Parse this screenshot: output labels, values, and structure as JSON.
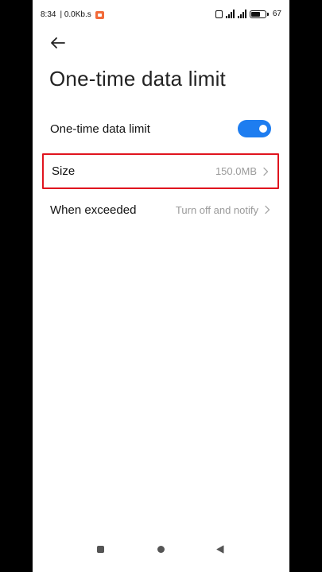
{
  "status_bar": {
    "time": "8:34",
    "network_speed": "| 0.0Kb.s",
    "battery_percent": "67",
    "icons": [
      "notification-icon",
      "vibrate-icon",
      "signal-icon",
      "signal-icon",
      "battery-icon"
    ]
  },
  "header": {
    "back_icon": "arrow-left-icon",
    "title": "One-time data limit"
  },
  "settings": {
    "toggle_row": {
      "label": "One-time data limit",
      "enabled": true,
      "accent": "#1e7df0"
    },
    "size_row": {
      "label": "Size",
      "value": "150.0MB"
    },
    "exceeded_row": {
      "label": "When exceeded",
      "value": "Turn off and notify"
    }
  },
  "nav_bar": {
    "icons": [
      "recents-icon",
      "home-icon",
      "back-icon"
    ]
  },
  "colors": {
    "highlight_border": "#e0141e",
    "secondary_text": "#9a9a9a"
  }
}
